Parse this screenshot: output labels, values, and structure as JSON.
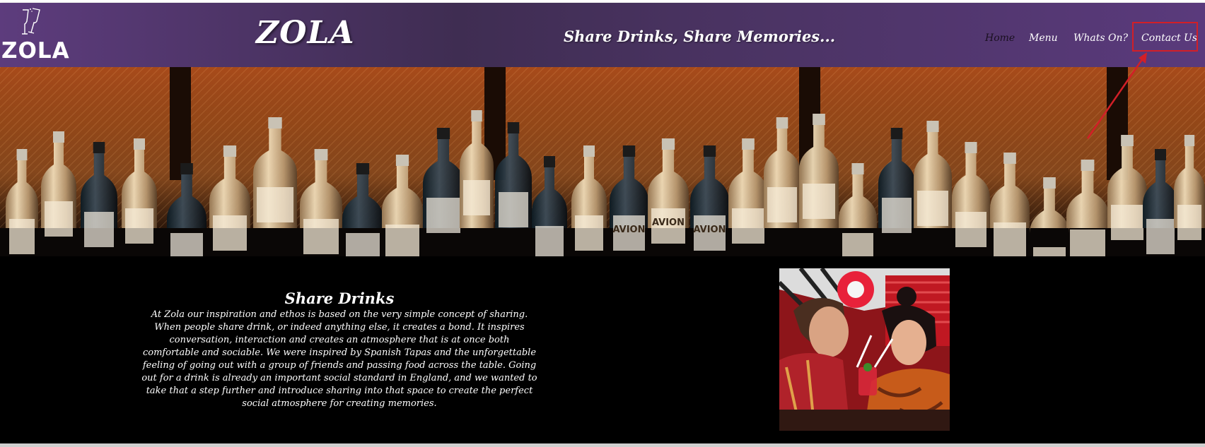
{
  "header": {
    "logo_text": "ZOLA",
    "site_title": "ZOLA",
    "tagline": "Share Drinks, Share Memories...",
    "nav": [
      {
        "label": "Home",
        "active": true
      },
      {
        "label": "Menu",
        "active": false
      },
      {
        "label": "Whats On?",
        "active": false
      },
      {
        "label": "Contact Us",
        "active": false
      }
    ]
  },
  "hero": {
    "bottle_labels": [
      "AVION",
      "AVION",
      "AVION"
    ]
  },
  "content": {
    "title": "Share Drinks",
    "body": "At Zola our inspiration and ethos is based on the very simple concept of sharing. When people share drink, or indeed anything else, it creates a bond. It inspires conversation, interaction and creates an atmosphere that is at once both comfortable and sociable. We were inspired by Spanish Tapas and the unforgettable feeling of going out with a group of friends and passing food across the table. Going out for a drink is already an important social standard in England, and we wanted to take that a step further and introduce sharing into that space to create the perfect social atmosphere for creating memories."
  },
  "colors": {
    "header_purple": "#5d3c7d",
    "annotation_red": "#d21f27",
    "background": "#000000"
  }
}
